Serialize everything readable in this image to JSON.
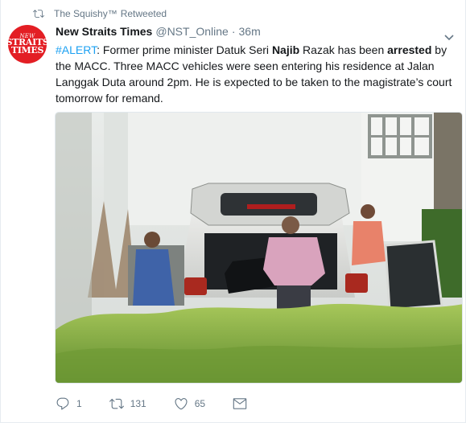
{
  "retweet_context": {
    "retweeter": "The Squishy™",
    "label": "Retweeted"
  },
  "author": {
    "avatar_text": [
      "NEW",
      "STRAITS",
      "TIMES"
    ],
    "name": "New Straits Times",
    "handle": "@NST_Online",
    "separator": "·",
    "time": "36m"
  },
  "tweet": {
    "hashtag": "#ALERT",
    "segments": [
      ": Former prime minister Datuk Seri ",
      "Najib",
      " Razak has been ",
      "arrested",
      " by the MACC. Three MACC vehicles were seen entering his residence at Jalan Langgak Duta around 2pm. He is expected to be taken to the magistrate’s court tomorrow for remand."
    ]
  },
  "actions": {
    "reply_count": "1",
    "retweet_count": "131",
    "like_count": "65"
  },
  "icons": {
    "retweet_context": "retweet-icon",
    "caret": "chevron-down-icon",
    "reply": "reply-icon",
    "retweet": "retweet-icon",
    "like": "heart-icon",
    "dm": "envelope-icon"
  },
  "colors": {
    "link": "#1da1f2",
    "muted": "#657786",
    "text": "#14171a",
    "avatar_bg": "#e31e24"
  }
}
